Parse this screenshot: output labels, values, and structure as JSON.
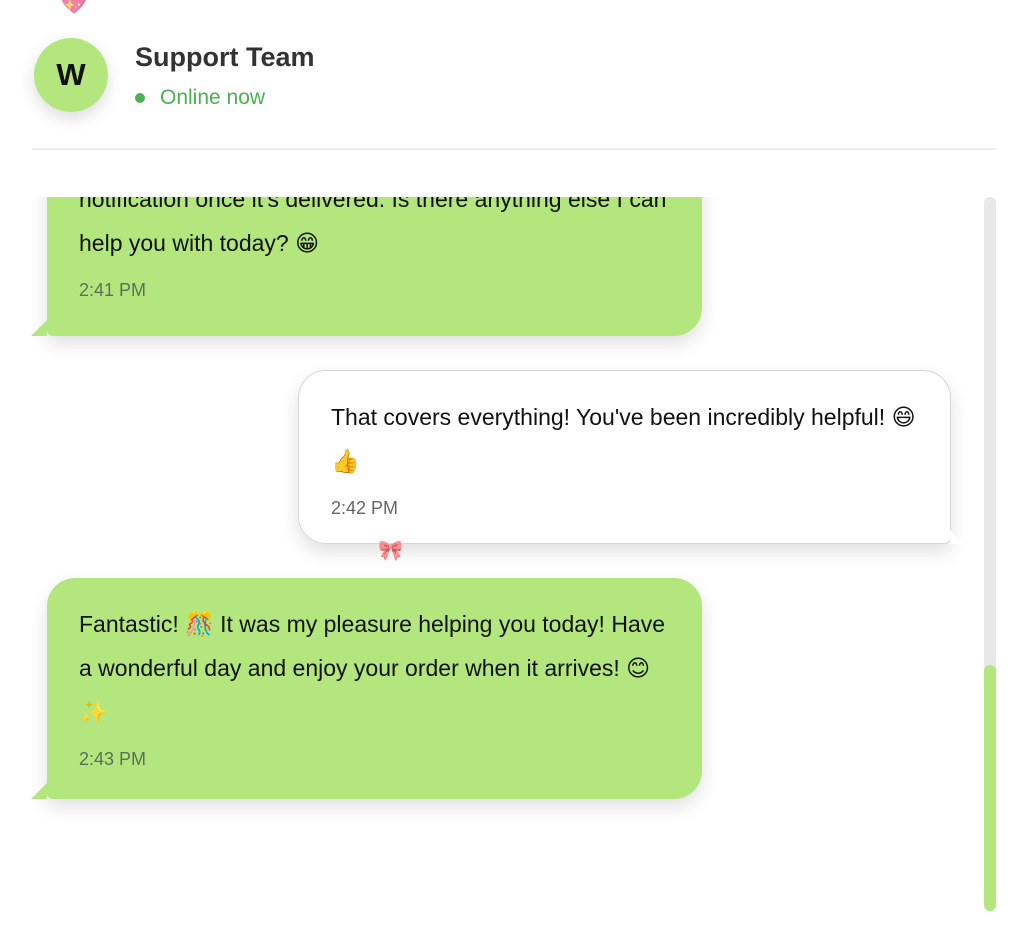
{
  "header": {
    "avatar_initial": "W",
    "contact_name": "Support Team",
    "status": "Online now"
  },
  "messages": [
    {
      "direction": "received",
      "text": "notification once it's delivered. Is there anything else I can help you with today? 😁",
      "time": "2:41 PM"
    },
    {
      "direction": "sent",
      "text": "That covers everything! You've been incredibly helpful! 😄 👍",
      "time": "2:42 PM"
    },
    {
      "direction": "received",
      "text": "Fantastic! 🎊 It was my pleasure helping you today! Have a wonderful day and enjoy your order when it arrives! 😊 ✨",
      "time": "2:43 PM"
    }
  ],
  "decorations": {
    "top_sparkle": "💖",
    "middle_sparkle": "🎀"
  },
  "icons": {
    "status": "online-dot-icon",
    "scroll": "scrollbar"
  },
  "colors": {
    "accent": "#b3e67d",
    "online": "#4caf50",
    "sent_bubble": "#ffffff",
    "received_bubble": "#b3e67d"
  }
}
